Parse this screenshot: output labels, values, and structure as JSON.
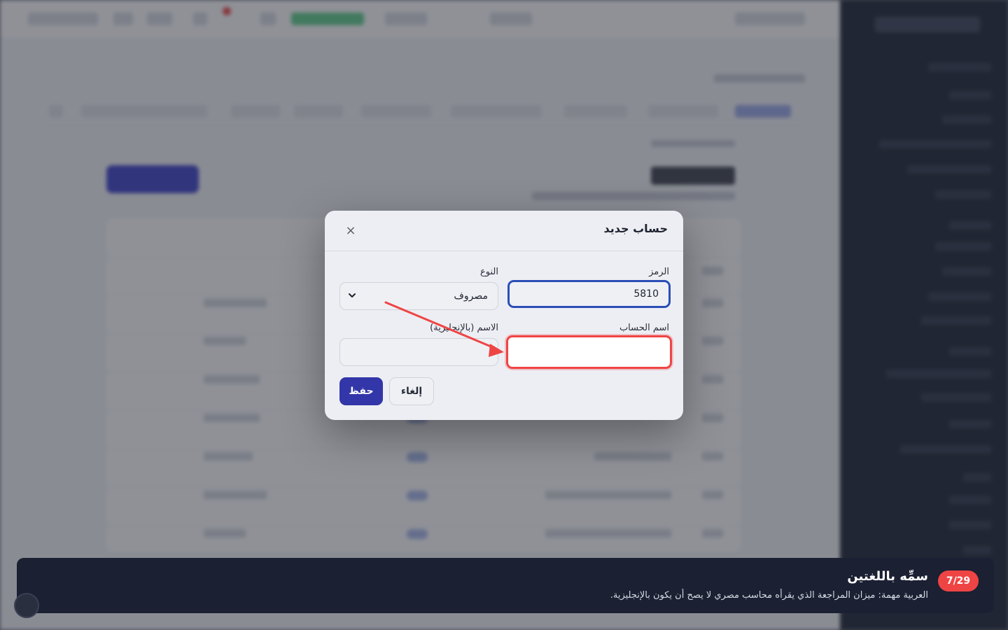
{
  "dialog": {
    "title": "حساب جديد",
    "code_label": "الرمز",
    "code_value": "5810",
    "type_label": "النوع",
    "type_value": "مصروف",
    "name_label": "اسم الحساب",
    "name_value": "",
    "name_en_label": "الاسم (بالإنجليزية)",
    "name_en_value": "",
    "save_label": "حفظ",
    "cancel_label": "إلغاء",
    "close_icon": "×"
  },
  "tour": {
    "step": "7/29",
    "title": "سمِّه باللغتين",
    "description": "العربية مهمة: ميزان المراجعة الذي يقرأه محاسب مصري لا يصح أن يكون بالإنجليزية."
  },
  "colors": {
    "primary": "#3236a8",
    "highlight": "#ef4444",
    "focus": "#2b4fb8",
    "tour_bg": "#1b2033"
  }
}
